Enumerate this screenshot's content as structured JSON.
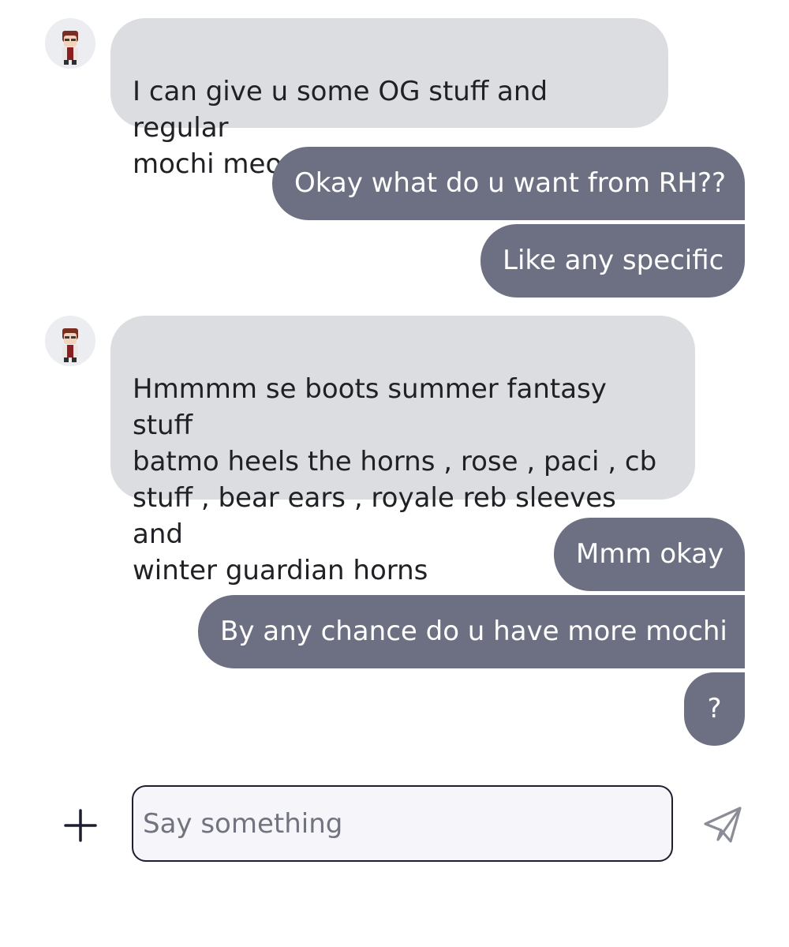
{
  "messages": [
    {
      "sender": "other",
      "text": "I can give u some OG stuff and regular\nmochi meow plus adds"
    },
    {
      "sender": "me",
      "text": "Okay what do u want from RH??"
    },
    {
      "sender": "me",
      "text": "Like any specific"
    },
    {
      "sender": "other",
      "text": "Hmmmm se boots summer fantasy stuff\nbatmo heels the horns , rose , paci , cb\nstuff , bear ears , royale reb sleeves and\nwinter guardian horns"
    },
    {
      "sender": "me",
      "text": "Mmm okay"
    },
    {
      "sender": "me",
      "text": "By any chance do u have more mochi"
    },
    {
      "sender": "me",
      "text": "?"
    }
  ],
  "composer": {
    "placeholder": "Say something",
    "value": ""
  },
  "icons": {
    "add": "plus-icon",
    "send": "paper-plane-icon"
  },
  "colors": {
    "incoming_bubble": "#dcdde1",
    "outgoing_bubble": "#6c7082",
    "incoming_text": "#202125",
    "outgoing_text": "#ffffff",
    "input_border": "#1c1f2e"
  }
}
